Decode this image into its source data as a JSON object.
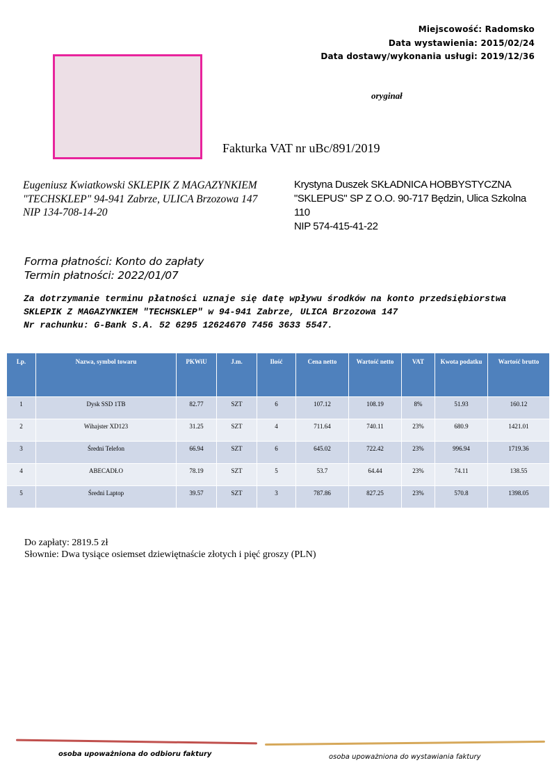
{
  "meta": {
    "place": "Miejscowość: Radomsko",
    "issue_date": "Data wystawienia:  2015/02/24",
    "delivery_date": "Data dostawy/wykonania  usługi:  2019/12/36"
  },
  "status": "oryginał",
  "title": "Fakturka  VAT  nr uBc/891/2019",
  "seller": {
    "line1": "Eugeniusz Kwiatkowski SKLEPIK Z MAGAZYNKIEM",
    "line2": "\"TECHSKLEP\" 94-941 Zabrze, ULICA Brzozowa 147",
    "line3": "NIP 134-708-14-20"
  },
  "buyer": {
    "line1": "Krystyna Duszek SKŁADNICA HOBBYSTYCZNA",
    "line2": "\"SKLEPUS\" SP Z O.O. 90-717 Będzin, Ulica Szkolna",
    "line3": "110",
    "line4": "NIP 574-415-41-22"
  },
  "payment": {
    "method": "Forma płatności: Konto do zapłaty",
    "due": "Termin płatności: 2022/01/07"
  },
  "note": {
    "text": "Za dotrzymanie terminu płatności uznaje się datę wpływu środków na konto przedsiębiorstwa SKLEPIK Z MAGAZYNKIEM \"TECHSKLEP\" w 94-941 Zabrze, ULICA Brzozowa 147",
    "account": "Nr rachunku: G-Bank S.A. 52 6295 12624670 7456 3633 5547."
  },
  "table": {
    "headers": [
      "Lp.",
      "Nazwa, symbol towaru",
      "PKWiU",
      "J.m.",
      "Ilość",
      "Cena netto",
      "Wartość netto",
      "VAT",
      "Kwota podatku",
      "Wartość brutto"
    ],
    "rows": [
      [
        "1",
        "Dysk SSD 1TB",
        "82.77",
        "SZT",
        "6",
        "107.12",
        "108.19",
        "8%",
        "51.93",
        "160.12"
      ],
      [
        "2",
        "Wihajster XD123",
        "31.25",
        "SZT",
        "4",
        "711.64",
        "740.11",
        "23%",
        "680.9",
        "1421.01"
      ],
      [
        "3",
        "Średni Telefon",
        "66.94",
        "SZT",
        "6",
        "645.02",
        "722.42",
        "23%",
        "996.94",
        "1719.36"
      ],
      [
        "4",
        "ABECADŁO",
        "78.19",
        "SZT",
        "5",
        "53.7",
        "64.44",
        "23%",
        "74.11",
        "138.55"
      ],
      [
        "5",
        "Średni Laptop",
        "39.57",
        "SZT",
        "3",
        "787.86",
        "827.25",
        "23%",
        "570.8",
        "1398.05"
      ]
    ]
  },
  "summary": {
    "to_pay": "Do zapłaty: 2819.5 zł",
    "in_words": "Słownie: Dwa tysiące osiemset dziewiętnaście złotych i pięć groszy (PLN)"
  },
  "signatures": {
    "receiver": "osoba upoważniona  do odbioru  faktury",
    "issuer": "osoba upoważniona  do wystawiania  faktury"
  },
  "colors": {
    "logo_border": "#e8239c",
    "logo_fill": "#eddfe6",
    "table_header": "#4f81bd",
    "row_odd": "#d0d8e8",
    "row_even": "#e9edf4"
  }
}
